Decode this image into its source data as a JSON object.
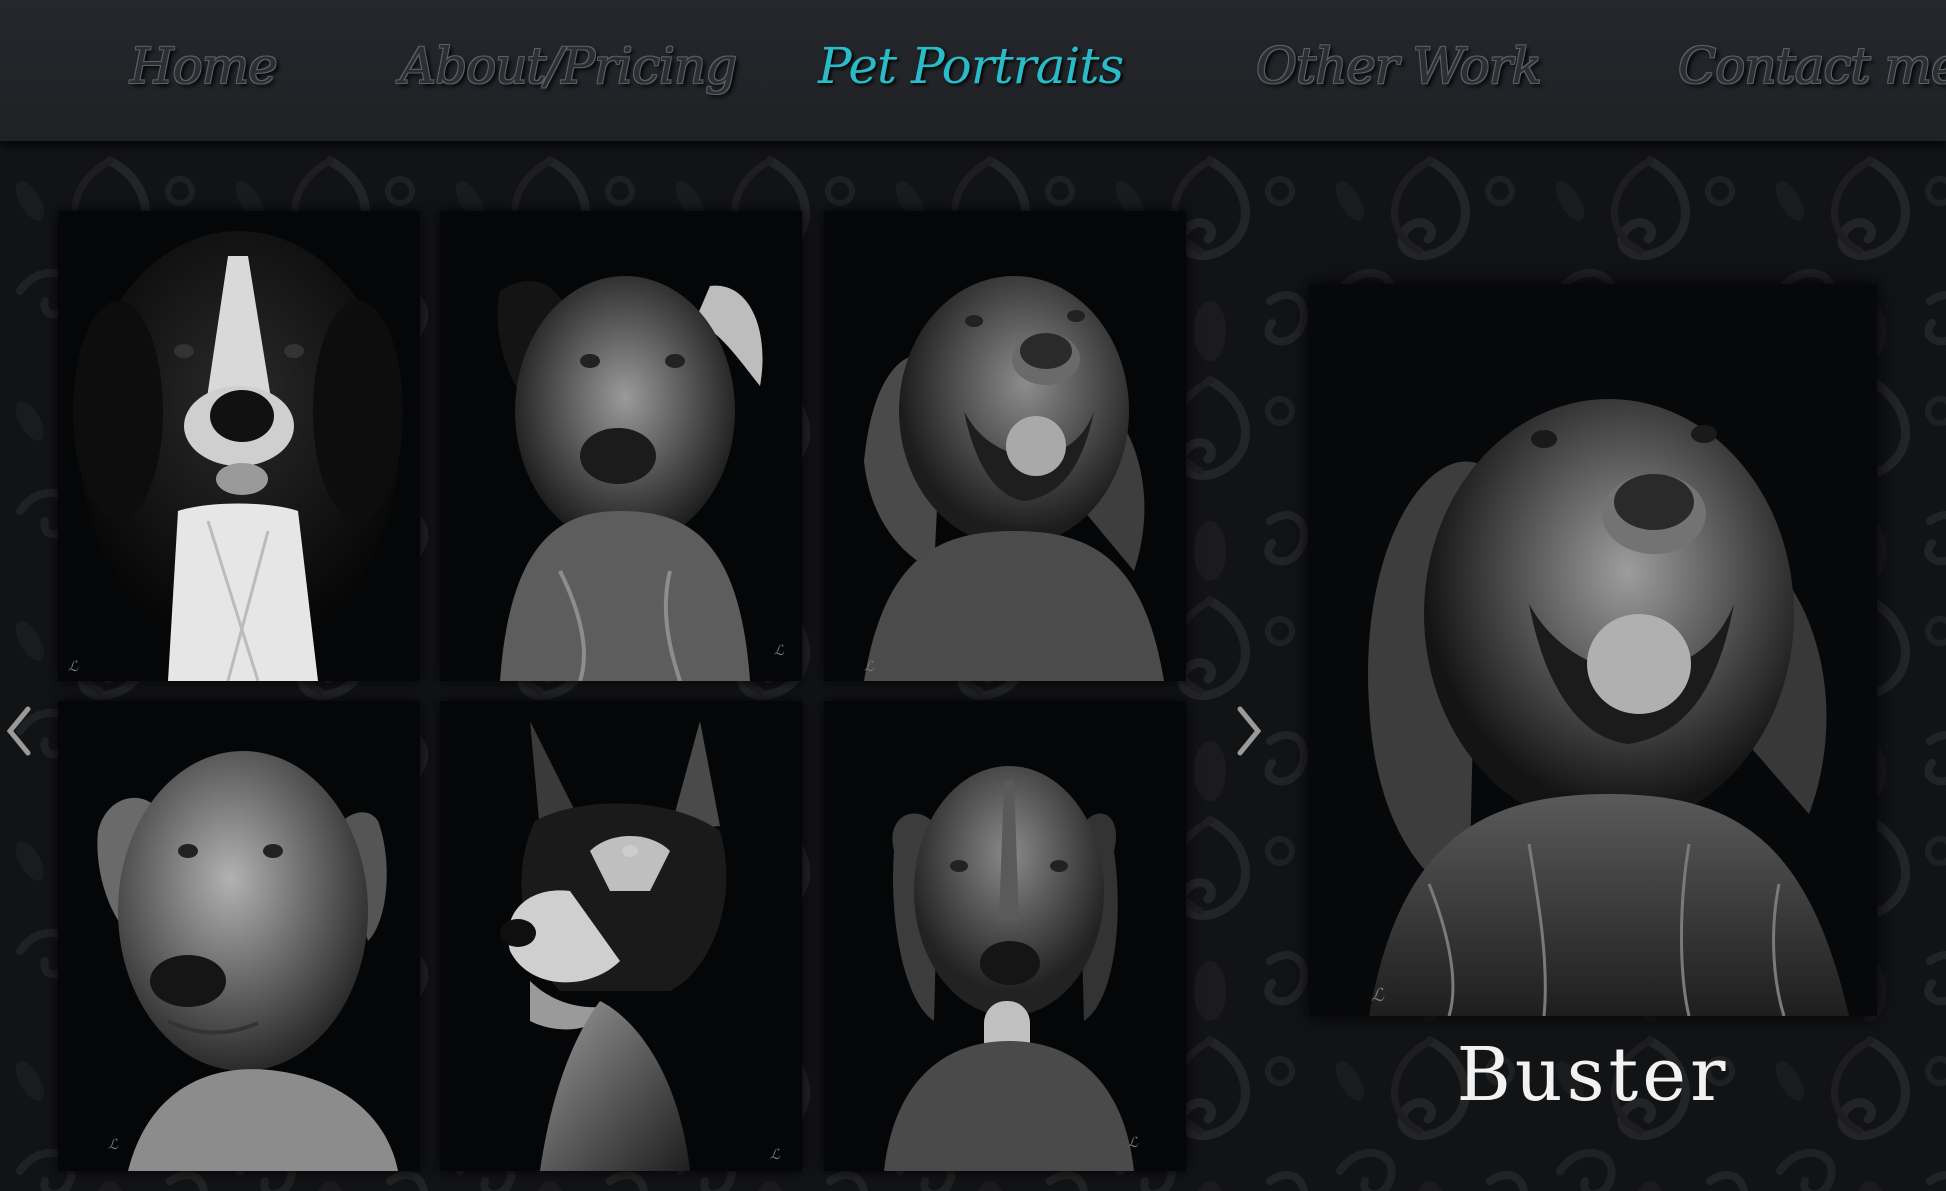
{
  "nav": {
    "items": [
      {
        "label": "Home",
        "active": false
      },
      {
        "label": "About/Pricing",
        "active": false
      },
      {
        "label": "Pet Portraits",
        "active": true
      },
      {
        "label": "Other Work",
        "active": false
      },
      {
        "label": "Contact me",
        "active": false
      }
    ],
    "active_color": "#29bcc8"
  },
  "gallery": {
    "thumbnails": [
      {
        "subject": "bernese-mountain-dog"
      },
      {
        "subject": "pit-bull-mix"
      },
      {
        "subject": "golden-retriever"
      },
      {
        "subject": "lab-mix"
      },
      {
        "subject": "german-shepherd"
      },
      {
        "subject": "hound"
      }
    ],
    "prev_icon": "chevron-left-icon",
    "next_icon": "chevron-right-icon"
  },
  "featured": {
    "caption": "Buster"
  }
}
